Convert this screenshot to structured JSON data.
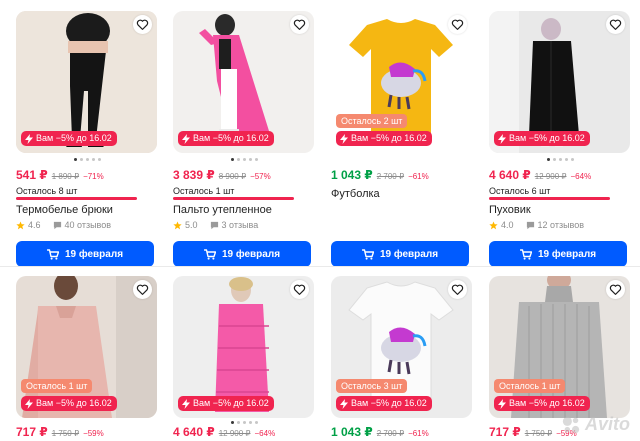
{
  "colors": {
    "price_red": "#f0244f",
    "price_green": "#00a046",
    "button_blue": "#005bff",
    "promo_red": "#f0244f",
    "left_badge": "#f5896f"
  },
  "cards": [
    {
      "price": "541 ₽",
      "old_price": "1 890 ₽",
      "discount": "−71%",
      "stock": "Осталось 8 шт",
      "title": "Термобелье брюки",
      "rating": "4.6",
      "reviews": "40 отзывов",
      "promo": "Вам −5% до 16.02",
      "delivery": "19 февраля"
    },
    {
      "price": "3 839 ₽",
      "old_price": "8 900 ₽",
      "discount": "−57%",
      "stock": "Осталось 1 шт",
      "title": "Пальто утепленное",
      "rating": "5.0",
      "reviews": "3 отзыва",
      "promo": "Вам −5% до 16.02",
      "delivery": "19 февраля"
    },
    {
      "price": "1 043 ₽",
      "old_price": "2 700 ₽",
      "discount": "−61%",
      "title": "Футболка",
      "left_badge": "Осталось 2 шт",
      "promo": "Вам −5% до 16.02",
      "delivery": "19 февраля"
    },
    {
      "price": "4 640 ₽",
      "old_price": "12 900 ₽",
      "discount": "−64%",
      "stock": "Осталось 6 шт",
      "title": "Пуховик",
      "rating": "4.0",
      "reviews": "12 отзывов",
      "promo": "Вам −5% до 16.02",
      "delivery": "19 февраля"
    },
    {
      "price": "717 ₽",
      "old_price": "1 750 ₽",
      "discount": "−59%",
      "left_badge": "Осталось 1 шт",
      "promo": "Вам −5% до 16.02"
    },
    {
      "price": "4 640 ₽",
      "old_price": "12 900 ₽",
      "discount": "−64%",
      "promo": "Вам −5% до 16.02"
    },
    {
      "price": "1 043 ₽",
      "old_price": "2 700 ₽",
      "discount": "−61%",
      "left_badge": "Осталось 3 шт",
      "promo": "Вам −5% до 16.02"
    },
    {
      "price": "717 ₽",
      "old_price": "1 750 ₽",
      "discount": "−59%",
      "left_badge": "Осталось 1 шт",
      "promo": "Вам −5% до 16.02"
    }
  ],
  "watermark": "Avito"
}
